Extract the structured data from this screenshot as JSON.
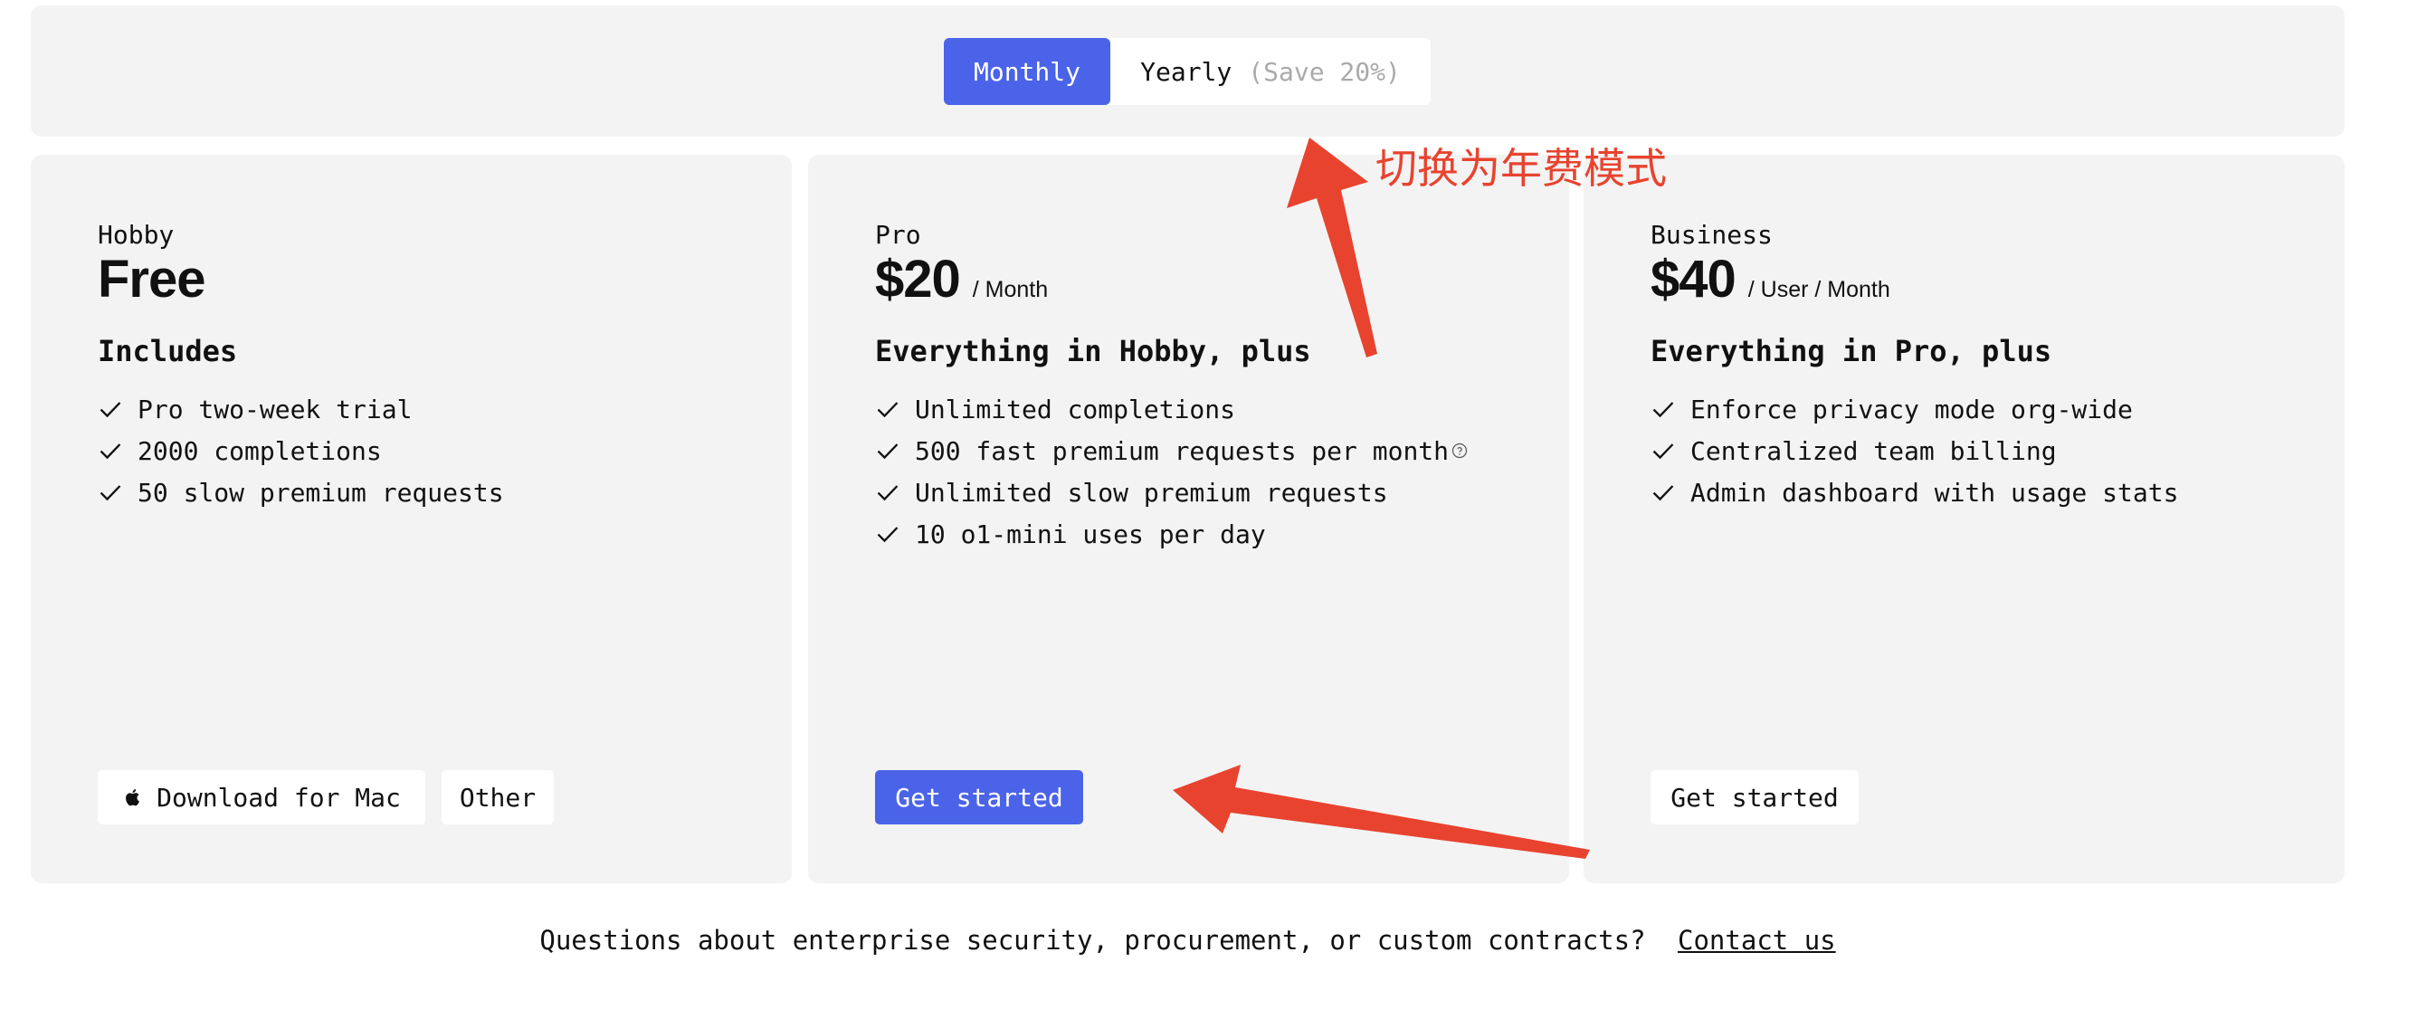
{
  "billing_toggle": {
    "monthly_label": "Monthly",
    "yearly_label": "Yearly",
    "yearly_savings": "(Save 20%)",
    "selected": "Monthly"
  },
  "plans": [
    {
      "tier": "Hobby",
      "price": "Free",
      "unit": "",
      "features_title": "Includes",
      "features": [
        "Pro two-week trial",
        "2000 completions",
        "50 slow premium requests"
      ],
      "buttons": [
        "Download for Mac",
        "Other"
      ]
    },
    {
      "tier": "Pro",
      "price": "$20",
      "unit": "/ Month",
      "features_title": "Everything in Hobby, plus",
      "features": [
        "Unlimited completions",
        "500 fast premium requests per month",
        "Unlimited slow premium requests",
        "10 o1-mini uses per day"
      ],
      "buttons": [
        "Get started"
      ]
    },
    {
      "tier": "Business",
      "price": "$40",
      "unit": "/ User / Month",
      "features_title": "Everything in Pro, plus",
      "features": [
        "Enforce privacy mode org-wide",
        "Centralized team billing",
        "Admin dashboard with usage stats"
      ],
      "buttons": [
        "Get started"
      ]
    }
  ],
  "footer": {
    "text": "Questions about enterprise security, procurement, or custom contracts?",
    "link": "Contact us"
  },
  "annotation": {
    "text": "切换为年费模式"
  },
  "colors": {
    "accent": "#4a63e8",
    "card_bg": "#f3f3f3",
    "annotation_red": "#e8432f"
  },
  "icons": {
    "check": "check-icon",
    "apple": "apple-icon",
    "help": "help-circle-icon"
  }
}
